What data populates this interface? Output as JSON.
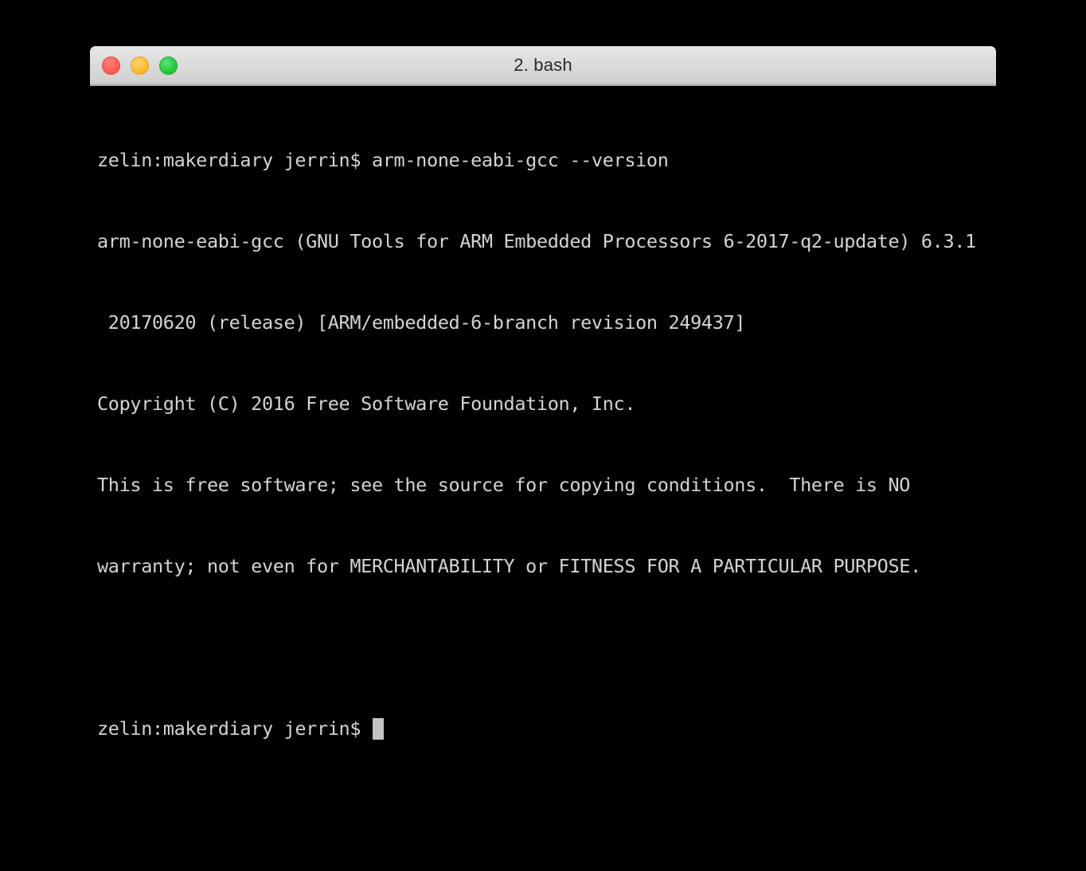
{
  "desktop": {
    "background_color": "#000000"
  },
  "window": {
    "title": "2. bash",
    "background_color": "#000000",
    "titlebar_color": "#dcdcdc",
    "controls": [
      {
        "name": "close",
        "label": "",
        "color": "#ff5f57"
      },
      {
        "name": "minimize",
        "label": "",
        "color": "#febc2e"
      },
      {
        "name": "maximize",
        "label": "",
        "color": "#28c840"
      }
    ]
  },
  "terminal": {
    "text_color": "#d4d4d4",
    "cursor_color": "#c3c3c3",
    "prompt": "zelin:makerdiary jerrin$ ",
    "lines": [
      "zelin:makerdiary jerrin$ arm-none-eabi-gcc --version",
      "arm-none-eabi-gcc (GNU Tools for ARM Embedded Processors 6-2017-q2-update) 6.3.1",
      " 20170620 (release) [ARM/embedded-6-branch revision 249437]",
      "Copyright (C) 2016 Free Software Foundation, Inc.",
      "This is free software; see the source for copying conditions.  There is NO",
      "warranty; not even for MERCHANTABILITY or FITNESS FOR A PARTICULAR PURPOSE.",
      ""
    ],
    "current_prompt": "zelin:makerdiary jerrin$ ",
    "command_entered": ""
  }
}
